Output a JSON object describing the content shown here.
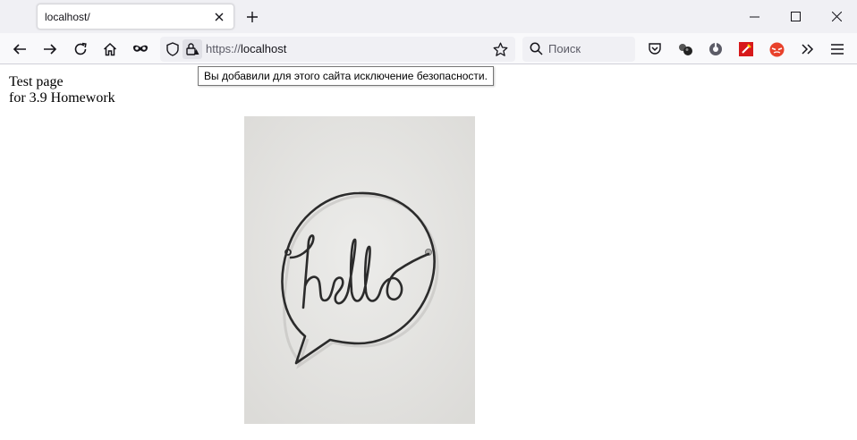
{
  "browser": {
    "tab": {
      "title": "localhost/"
    },
    "url": {
      "protocol": "https://",
      "host": "localhost"
    },
    "search": {
      "placeholder": "Поиск"
    },
    "tooltip": "Вы добавили для этого сайта исключение безопасности."
  },
  "page": {
    "line1": "Test page",
    "line2": "for 3.9 Homework",
    "image": {
      "subject": "wire speech-bubble sign",
      "script_text": "hello"
    }
  },
  "colors": {
    "toolbar_bg": "#f9f9fb",
    "tabstrip_bg": "#f0f0f4",
    "photo_bg": "#e6e5e3",
    "wire": "#2b2b2b"
  }
}
